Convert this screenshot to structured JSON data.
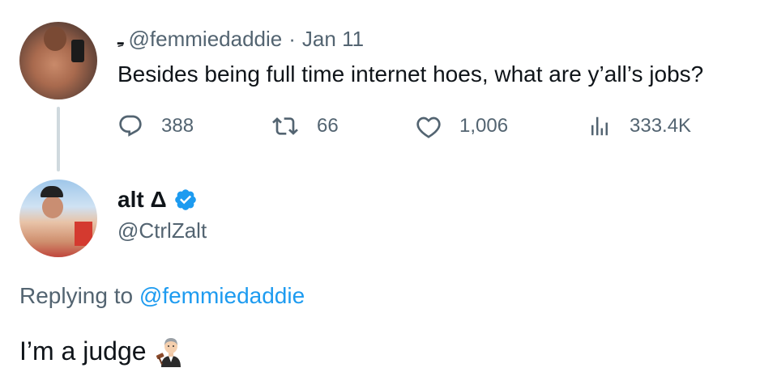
{
  "parent": {
    "avatar_icon": "user-avatar-photo",
    "name_mark": "ـِ",
    "handle": "@femmiedaddie",
    "separator": "·",
    "date": "Jan 11",
    "text": "Besides being full time internet hoes, what are y’all’s jobs?",
    "stats": {
      "replies": "388",
      "retweets": "66",
      "likes": "1,006",
      "views": "333.4K"
    },
    "icons": {
      "reply": "comment-bubble-icon",
      "retweet": "retweet-icon",
      "like": "heart-icon",
      "views": "bar-chart-icon"
    }
  },
  "reply": {
    "avatar_icon": "user-avatar-photo",
    "display_name": "alt Δ",
    "verified_icon": "verified-badge-icon",
    "handle": "@CtrlZalt",
    "replying_prefix": "Replying to ",
    "replying_handle": "@femmiedaddie",
    "text": "I’m a judge",
    "emoji_icon": "judge-emoji"
  },
  "colors": {
    "text_primary": "#0f1419",
    "text_secondary": "#536471",
    "link": "#1d9bf0",
    "thread_line": "#cfd9de",
    "verified": "#1d9bf0"
  }
}
